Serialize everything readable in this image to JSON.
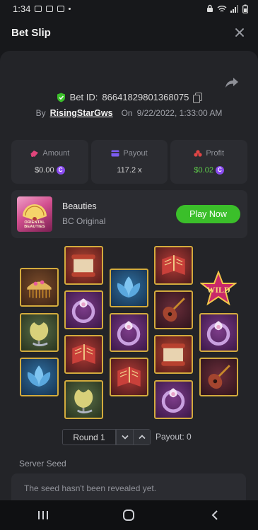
{
  "status_bar": {
    "time": "1:34",
    "battery": ""
  },
  "header": {
    "title": "Bet Slip"
  },
  "bet": {
    "id_label": "Bet ID:",
    "id": "86641829801368075",
    "by_label": "By",
    "user": "RisingStarGws",
    "on_label": "On",
    "date": "9/22/2022, 1:33:00 AM"
  },
  "stats": {
    "amount_label": "Amount",
    "amount_value": "$0.00",
    "payout_label": "Payout",
    "payout_value": "117.2 x",
    "profit_label": "Profit",
    "profit_value": "$0.02",
    "coin_symbol": "C"
  },
  "game": {
    "name": "Beauties",
    "subtitle": "BC Original",
    "thumb_text": "ORIENTAL BEAUTIES",
    "play_label": "Play Now"
  },
  "symbols": {
    "wild_text": "WILD"
  },
  "round": {
    "label": "Round 1",
    "payout": "Payout: 0"
  },
  "seed": {
    "label": "Server Seed",
    "message": "The seed hasn't been revealed yet."
  },
  "colors": {
    "accent_green": "#3bbf2a",
    "profit_green": "#5fd14b",
    "coin_purple": "#8a4cf0",
    "tile_border": "#d3ab3d"
  }
}
